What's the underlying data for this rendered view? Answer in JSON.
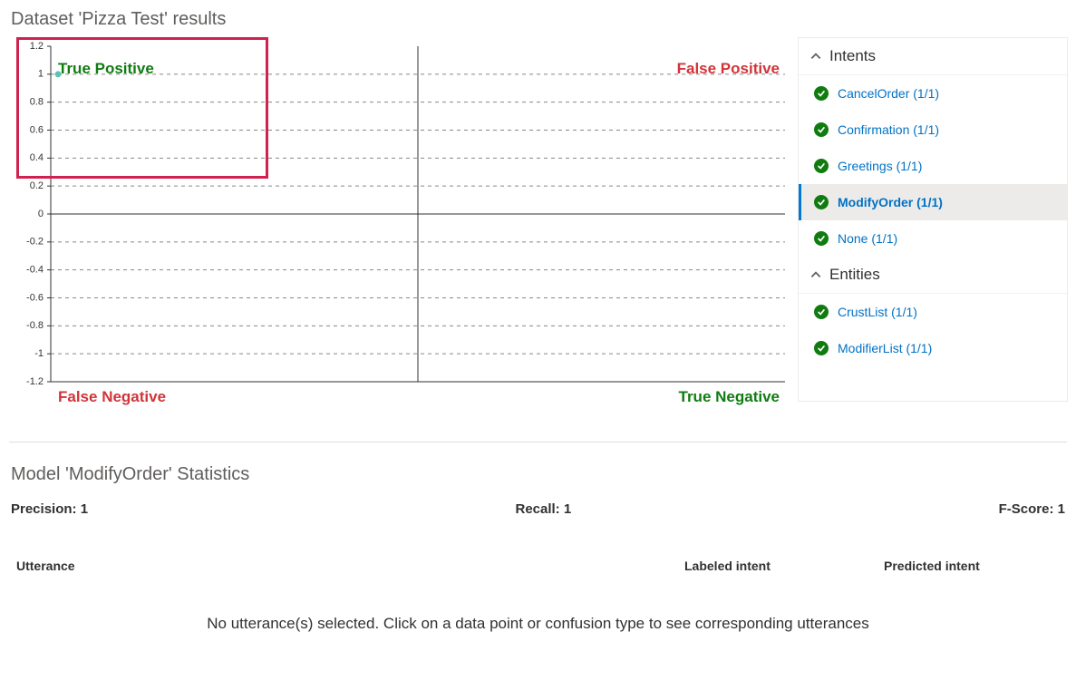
{
  "header": {
    "title": "Dataset 'Pizza Test' results"
  },
  "chart_data": {
    "type": "scatter",
    "title": "",
    "xlabel": "",
    "ylabel": "",
    "xlim": [
      -1,
      1
    ],
    "ylim": [
      -1.2,
      1.2
    ],
    "yticks": [
      -1.2,
      -1,
      -0.8,
      -0.6,
      -0.4,
      -0.2,
      0,
      0.2,
      0.4,
      0.6,
      0.8,
      1,
      1.2
    ],
    "grid": true,
    "series": [
      {
        "name": "ModifyOrder",
        "values": [
          {
            "x": -0.98,
            "y": 1
          }
        ]
      }
    ],
    "quadrants": {
      "top_left": {
        "label": "True Positive",
        "kind": "positive"
      },
      "top_right": {
        "label": "False Positive",
        "kind": "negative"
      },
      "bottom_left": {
        "label": "False Negative",
        "kind": "negative"
      },
      "bottom_right": {
        "label": "True Negative",
        "kind": "positive"
      }
    }
  },
  "sidebar": {
    "sections": [
      {
        "title": "Intents",
        "items": [
          {
            "label": "CancelOrder (1/1)",
            "status": "ok",
            "selected": false
          },
          {
            "label": "Confirmation (1/1)",
            "status": "ok",
            "selected": false
          },
          {
            "label": "Greetings (1/1)",
            "status": "ok",
            "selected": false
          },
          {
            "label": "ModifyOrder (1/1)",
            "status": "ok",
            "selected": true
          },
          {
            "label": "None (1/1)",
            "status": "ok",
            "selected": false
          }
        ]
      },
      {
        "title": "Entities",
        "items": [
          {
            "label": "CrustList (1/1)",
            "status": "ok",
            "selected": false
          },
          {
            "label": "ModifierList (1/1)",
            "status": "ok",
            "selected": false
          }
        ]
      }
    ]
  },
  "stats": {
    "title": "Model 'ModifyOrder' Statistics",
    "precision_label": "Precision: 1",
    "recall_label": "Recall: 1",
    "fscore_label": "F-Score: 1"
  },
  "table": {
    "headers": {
      "utterance": "Utterance",
      "labeled": "Labeled intent",
      "predicted": "Predicted intent"
    },
    "empty_message": "No utterance(s) selected. Click on a data point or confusion type to see corresponding utterances"
  }
}
